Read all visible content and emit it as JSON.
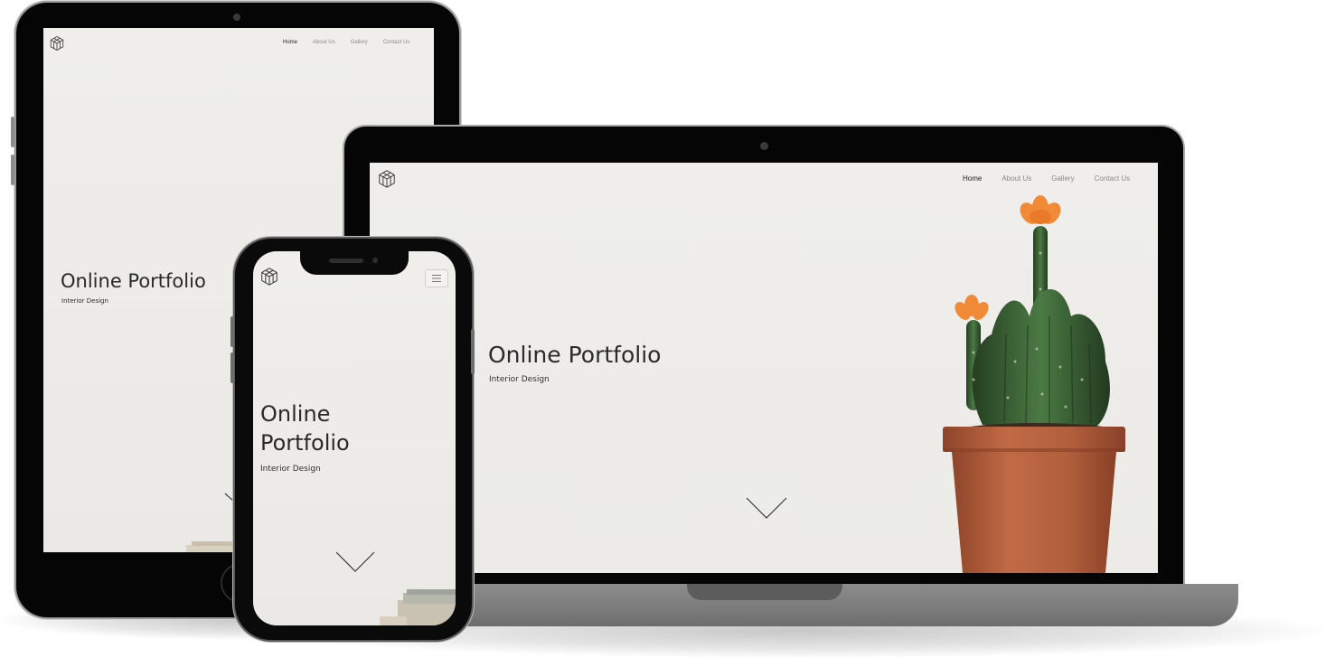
{
  "site": {
    "nav": {
      "home": "Home",
      "about": "About Us",
      "gallery": "Gallery",
      "contact": "Contact Us"
    },
    "hero": {
      "title": "Online Portfolio",
      "subtitle": "Interior Design",
      "title_line_1": "Online",
      "title_line_2": "Portfolio"
    }
  },
  "icons": {
    "logo": "isometric-cube-logo-icon",
    "scroll": "chevron-down-icon",
    "menu": "hamburger-menu-icon"
  },
  "colors": {
    "screen_background": "#eeede9",
    "device_frame": "#050505",
    "laptop_base": "#808080",
    "text_primary": "#2a2a2a",
    "nav_inactive": "#8a8a8a",
    "pot": "#b0603e",
    "cactus": "#3f6b3a",
    "flower": "#f08a36"
  }
}
